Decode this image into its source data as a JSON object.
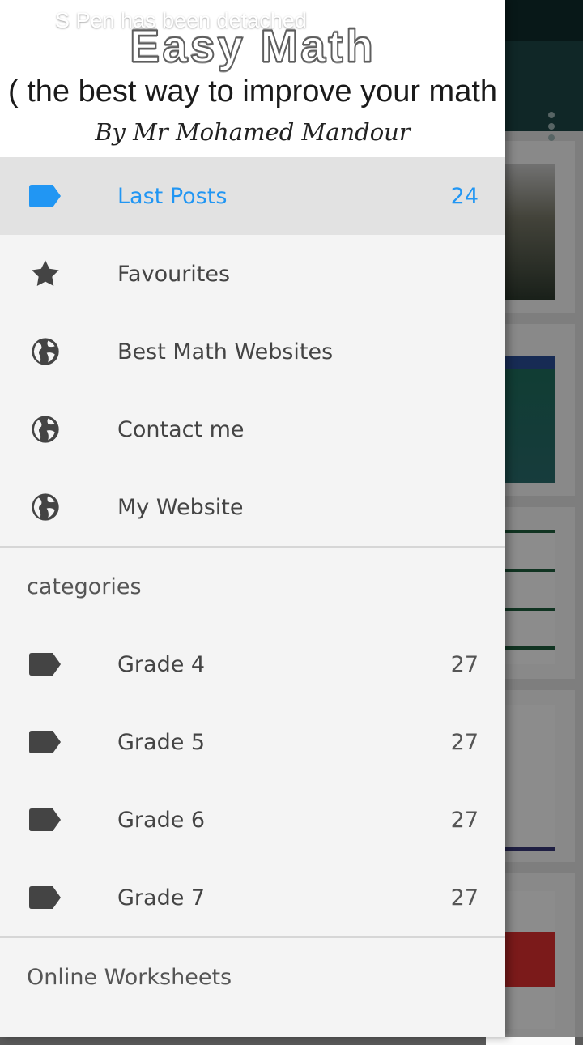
{
  "status_bar": {
    "notification_text": "S Pen has been detached",
    "notification_icon": "pen-icon"
  },
  "drawer_header": {
    "title": "Easy Math",
    "subtitle": "( the best way to improve your math )",
    "byline": "By Mr Mohamed Mandour"
  },
  "menu": {
    "items": [
      {
        "label": "Last Posts",
        "count": "24",
        "icon": "label-tag-icon",
        "active": true
      },
      {
        "label": "Favourites",
        "count": "",
        "icon": "star-icon"
      },
      {
        "label": "Best Math Websites",
        "count": "",
        "icon": "globe-icon"
      },
      {
        "label": "Contact me",
        "count": "",
        "icon": "globe-icon"
      },
      {
        "label": "My Website",
        "count": "",
        "icon": "globe-icon"
      }
    ]
  },
  "categories": {
    "header": "categories",
    "items": [
      {
        "label": "Grade 4",
        "count": "27",
        "icon": "label-tag-icon"
      },
      {
        "label": "Grade 5",
        "count": "27",
        "icon": "label-tag-icon"
      },
      {
        "label": "Grade 6",
        "count": "27",
        "icon": "label-tag-icon"
      },
      {
        "label": "Grade 7",
        "count": "27",
        "icon": "label-tag-icon"
      }
    ]
  },
  "online_worksheets": {
    "header": "Online Worksheets"
  },
  "colors": {
    "accent": "#2196f3",
    "toolbar": "#1e4848",
    "drawer_bg": "#f4f4f4",
    "active_row": "#e2e2e2",
    "icon": "#444444"
  }
}
